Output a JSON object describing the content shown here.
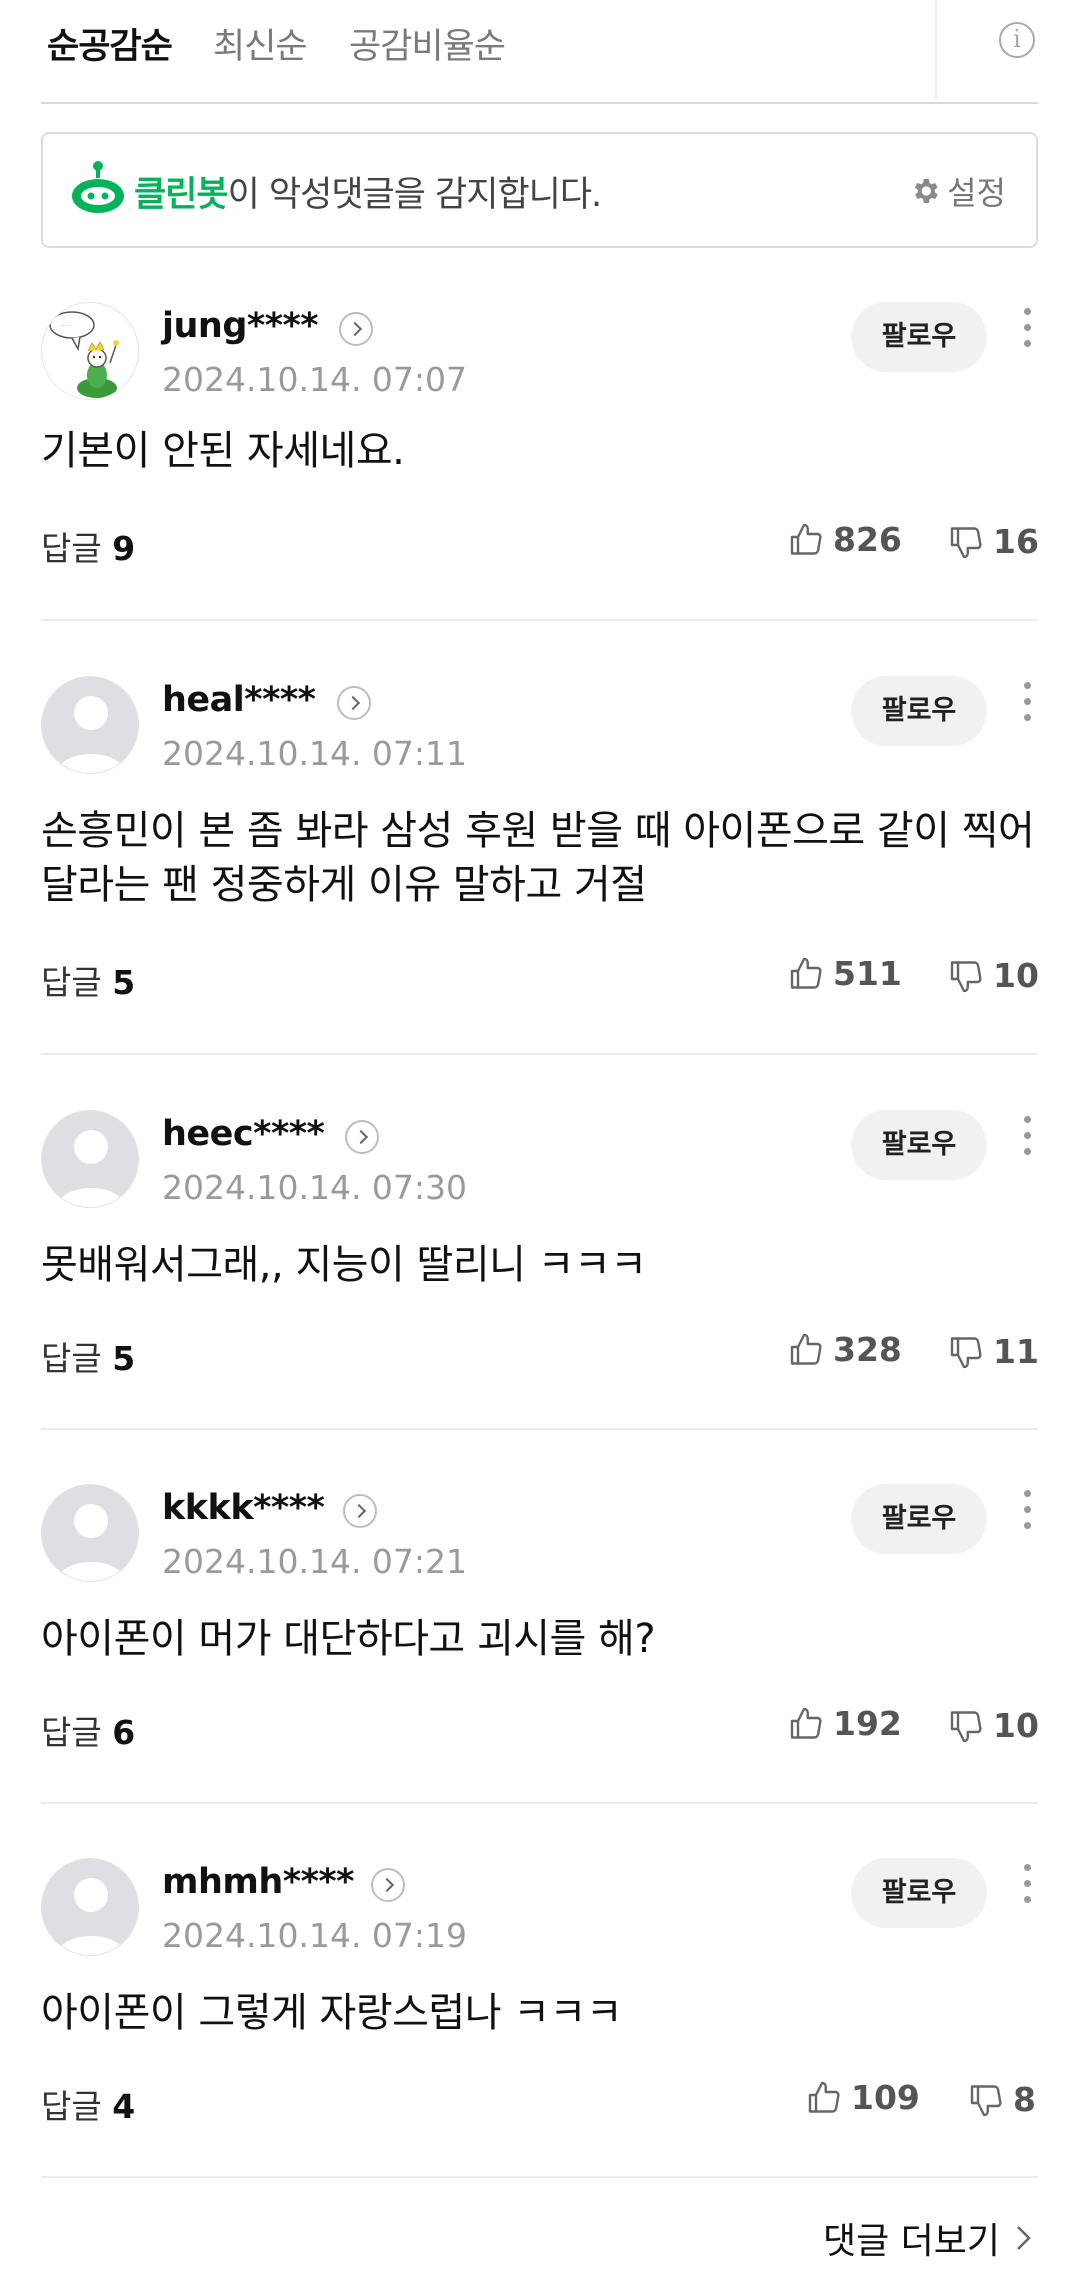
{
  "sort_tabs": [
    {
      "label": "순공감순",
      "active": true
    },
    {
      "label": "최신순",
      "active": false
    },
    {
      "label": "공감비율순",
      "active": false
    }
  ],
  "cleanbot": {
    "name": "클린봇",
    "message": "이 악성댓글을 감지합니다.",
    "settings_label": "설정",
    "brand_color": "#03b35a"
  },
  "follow_label": "팔로우",
  "reply_label": "답글",
  "comments": [
    {
      "username": "jung****",
      "date": "2024.10.14. 07:07",
      "text": "기본이 안된 자세네요.",
      "replies": "9",
      "likes": "826",
      "dislikes": "16",
      "avatar": "custom-illustration"
    },
    {
      "username": "heal****",
      "date": "2024.10.14. 07:11",
      "text": "손흥민이 본 좀 봐라 삼성 후원 받을 때 아이폰으로 같이 찍어달라는 팬 정중하게 이유 말하고 거절",
      "replies": "5",
      "likes": "511",
      "dislikes": "10",
      "avatar": "default"
    },
    {
      "username": "heec****",
      "date": "2024.10.14. 07:30",
      "text": "못배워서그래,, 지능이 딸리니 ㅋㅋㅋ",
      "replies": "5",
      "likes": "328",
      "dislikes": "11",
      "avatar": "default"
    },
    {
      "username": "kkkk****",
      "date": "2024.10.14. 07:21",
      "text": "아이폰이 머가 대단하다고 괴시를 해?",
      "replies": "6",
      "likes": "192",
      "dislikes": "10",
      "avatar": "default"
    },
    {
      "username": "mhmh****",
      "date": "2024.10.14. 07:19",
      "text": "아이폰이 그렇게 자랑스럽나 ㅋㅋㅋ",
      "replies": "4",
      "likes": "109",
      "dislikes": "8",
      "avatar": "default"
    }
  ],
  "more_comments_label": "댓글 더보기"
}
